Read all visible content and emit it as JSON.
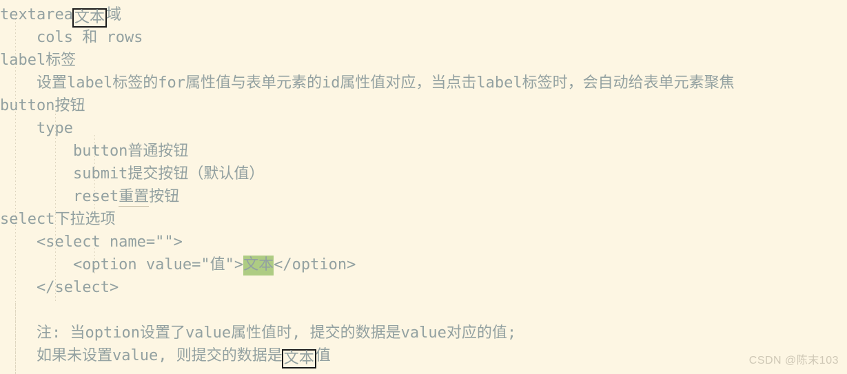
{
  "theme": {
    "background": "#fdf6e3",
    "text_color": "#93a1a1",
    "highlight_green": "#aecc83",
    "box_outline": "#1a1a1a",
    "guide_color": "#ded6c0",
    "watermark_color": "#cfc8b6"
  },
  "lines": {
    "l1_a": "textarea",
    "l1_box": "文本",
    "l1_b": "域",
    "l2": "    cols 和 rows",
    "l3": "label标签",
    "l4": "    设置label标签的for属性值与表单元素的id属性值对应，当点击label标签时，会自动给表单元素聚焦",
    "l5": "button按钮",
    "l6": "    type",
    "l7": "        button普通按钮",
    "l8": "        submit提交按钮（默认值）",
    "l9_a": "        reset",
    "l9_u": "重置",
    "l9_b": "按钮",
    "l10": "select下拉选项",
    "l11": "    <select name=\"\">",
    "l12_a": "        <option value=\"值\">",
    "l12_hl": "文本",
    "l12_b": "</option>",
    "l13": "    </select>",
    "l14": "",
    "l15": "    注: 当option设置了value属性值时, 提交的数据是value对应的值;",
    "l16_a": "    如果未设置value, 则提交的数据是",
    "l16_box": "文本",
    "l16_b": "值"
  },
  "watermark": {
    "text": "CSDN @陈末103"
  }
}
